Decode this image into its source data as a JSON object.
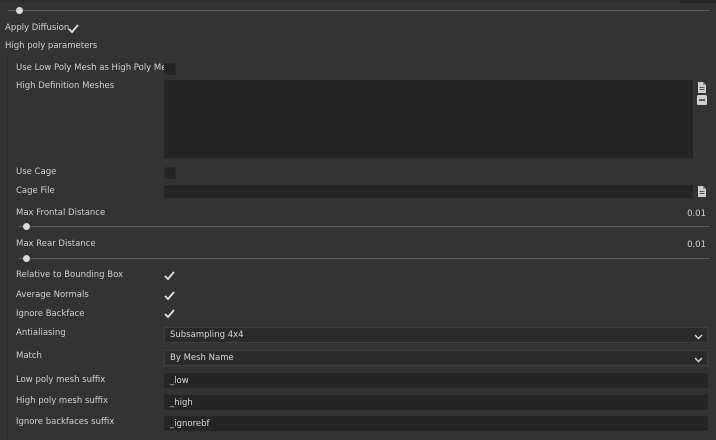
{
  "apply_diffusion": {
    "label": "Apply Diffusion",
    "checked": true,
    "slider_value": 0.02
  },
  "section_title": "High poly parameters",
  "use_low_poly_as_high": {
    "label": "Use Low Poly Mesh as High Poly Mesh",
    "checked": false
  },
  "hd_meshes": {
    "label": "High Definition Meshes",
    "add_icon": "file-icon",
    "remove_icon": "minus-icon"
  },
  "use_cage": {
    "label": "Use Cage",
    "checked": false
  },
  "cage_file": {
    "label": "Cage File",
    "value": "",
    "browse_icon": "file-icon"
  },
  "max_frontal": {
    "label": "Max Frontal Distance",
    "value": "0.01",
    "slider_value": 0.01
  },
  "max_rear": {
    "label": "Max Rear Distance",
    "value": "0.01",
    "slider_value": 0.01
  },
  "relative_bbox": {
    "label": "Relative to Bounding Box",
    "checked": true
  },
  "average_normals": {
    "label": "Average Normals",
    "checked": true
  },
  "ignore_backface": {
    "label": "Ignore Backface",
    "checked": true
  },
  "antialiasing": {
    "label": "Antialiasing",
    "value": "Subsampling 4x4"
  },
  "match": {
    "label": "Match",
    "value": "By Mesh Name"
  },
  "low_suffix": {
    "label": "Low poly mesh suffix",
    "value": "_low"
  },
  "high_suffix": {
    "label": "High poly mesh suffix",
    "value": "_high"
  },
  "ignore_bf_suffix": {
    "label": "Ignore backfaces suffix",
    "value": "_ignorebf"
  },
  "colors": {
    "background": "#333333",
    "field": "#242424",
    "text": "#d2d2d2",
    "accent": "#e0e0e0"
  }
}
